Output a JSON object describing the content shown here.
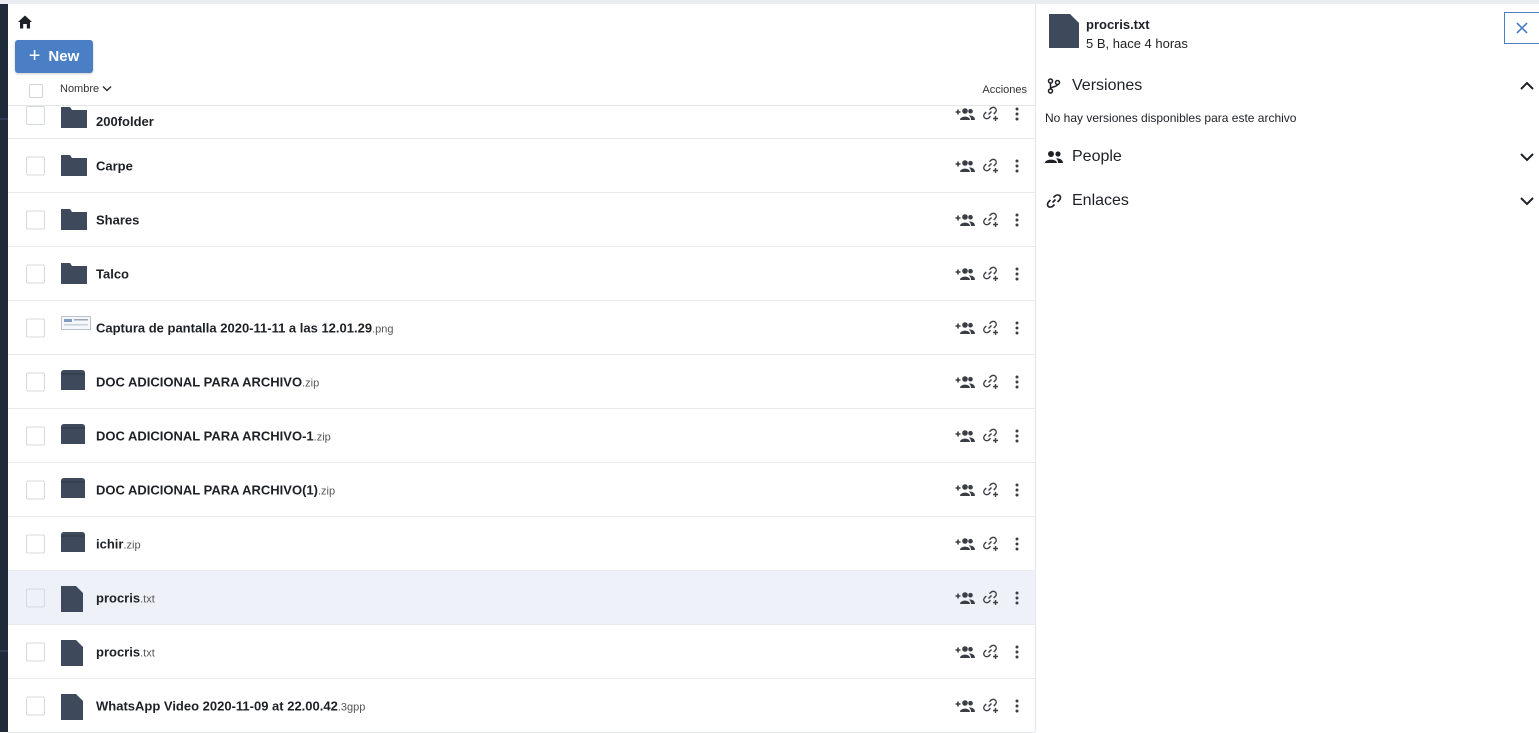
{
  "toolbar": {
    "new_label": "New"
  },
  "table": {
    "name_header": "Nombre",
    "actions_header": "Acciones"
  },
  "files": [
    {
      "base": "200folder",
      "ext": "",
      "kind": "folder"
    },
    {
      "base": "Carpe",
      "ext": "",
      "kind": "folder"
    },
    {
      "base": "Shares",
      "ext": "",
      "kind": "folder"
    },
    {
      "base": "Talco",
      "ext": "",
      "kind": "folder"
    },
    {
      "base": "Captura de pantalla 2020-11-11 a las 12.01.29",
      "ext": ".png",
      "kind": "image"
    },
    {
      "base": "DOC ADICIONAL PARA ARCHIVO",
      "ext": ".zip",
      "kind": "archive"
    },
    {
      "base": "DOC ADICIONAL PARA ARCHIVO-1",
      "ext": ".zip",
      "kind": "archive"
    },
    {
      "base": "DOC ADICIONAL PARA ARCHIVO(1)",
      "ext": ".zip",
      "kind": "archive"
    },
    {
      "base": "ichir",
      "ext": ".zip",
      "kind": "archive"
    },
    {
      "base": "procris",
      "ext": ".txt",
      "kind": "file",
      "selected": true
    },
    {
      "base": "procris",
      "ext": ".txt",
      "kind": "file"
    },
    {
      "base": "WhatsApp Video 2020-11-09 at 22.00.42",
      "ext": ".3gpp",
      "kind": "file"
    }
  ],
  "details": {
    "title": "procris.txt",
    "meta": "5 B, hace 4 horas",
    "versions_label": "Versiones",
    "versions_empty": "No hay versiones disponibles para este archivo",
    "people_label": "People",
    "links_label": "Enlaces"
  },
  "colors": {
    "accent": "#4a7fc6",
    "icon": "#3e4a5c",
    "selected_row": "#eef2f8"
  }
}
